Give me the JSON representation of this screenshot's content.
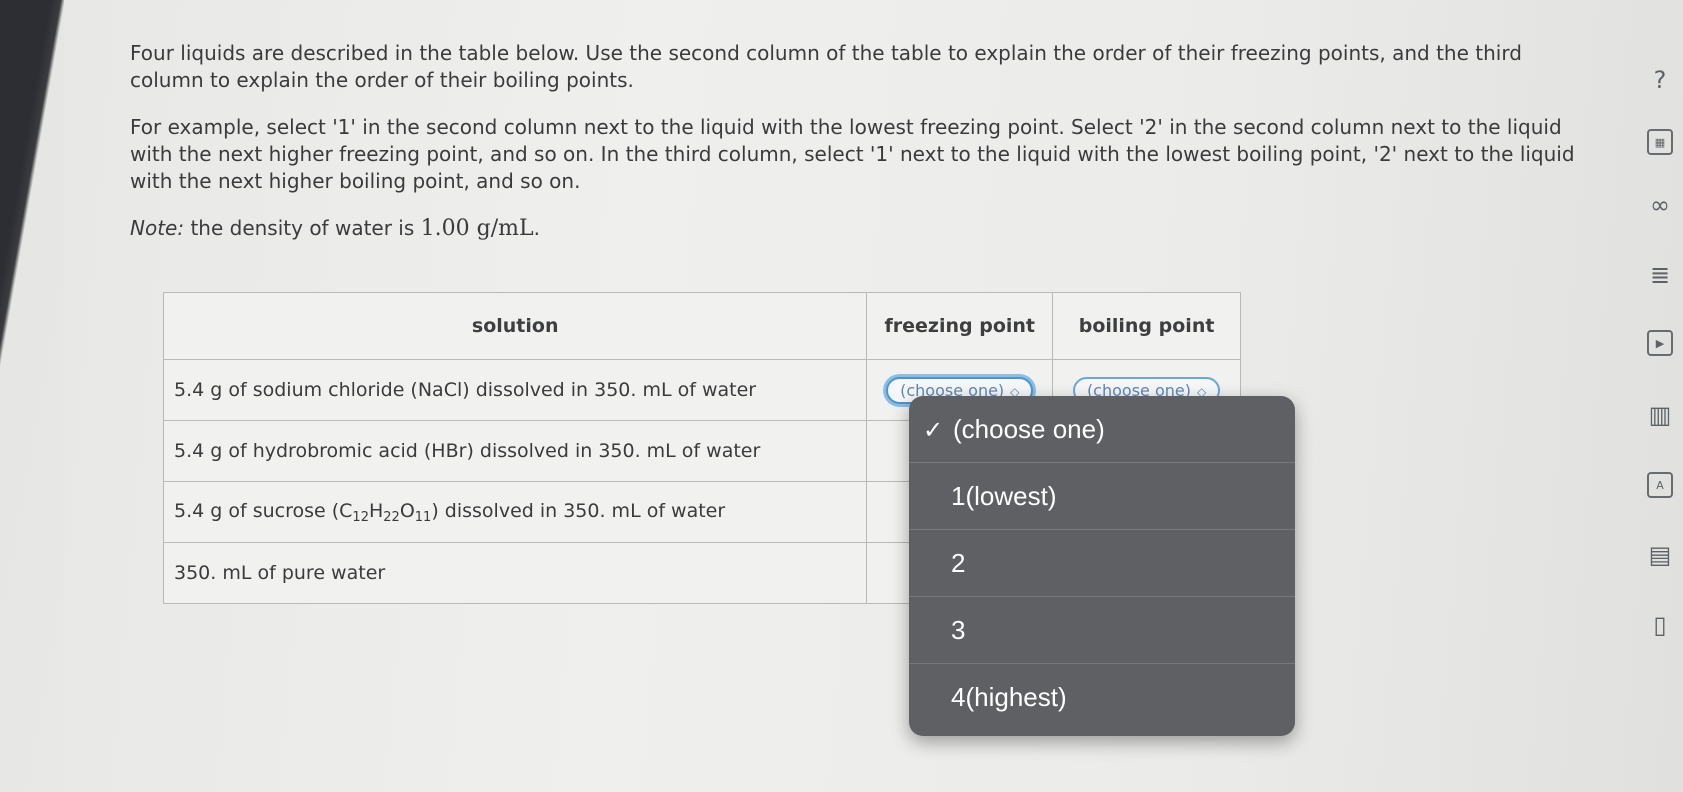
{
  "prompt": {
    "paragraph1": "Four liquids are described in the table below. Use the second column of the table to explain the order of their freezing points, and the third column to explain the order of their boiling points.",
    "paragraph2": "For example, select '1' in the second column next to the liquid with the lowest freezing point. Select '2' in the second column next to the liquid with the next higher freezing point, and so on. In the third column, select '1' next to the liquid with the lowest boiling point, '2' next to the liquid with the next higher boiling point, and so on.",
    "note_label": "Note:",
    "note_text": "the density of water is",
    "note_value": "1.00 g/mL",
    "note_end": "."
  },
  "table": {
    "headers": {
      "solution": "solution",
      "freezing": "freezing point",
      "boiling": "boiling point"
    },
    "rows": [
      {
        "text": "5.4 g of sodium chloride (NaCl) dissolved in 350. mL of water",
        "fp": "(choose one)",
        "bp": "(choose one)"
      },
      {
        "text": "5.4 g of hydrobromic acid (HBr) dissolved in 350. mL of water"
      },
      {
        "pre": "5.4 g of sucrose (C",
        "s1": "12",
        "h": "H",
        "s2": "22",
        "o": "O",
        "s3": "11",
        "post": ") dissolved in 350. mL of water"
      },
      {
        "text": "350. mL of pure water"
      }
    ]
  },
  "dropdown": {
    "check": "✓",
    "options": [
      "(choose one)",
      "1(lowest)",
      "2",
      "3",
      "4(highest)"
    ],
    "selected_index": 0
  },
  "toolbar": {
    "help": "?",
    "icons": [
      "question-icon",
      "calculator-icon",
      "infinity-icon",
      "notes-icon",
      "video-icon",
      "chart-icon",
      "periodic-table-icon",
      "book-icon",
      "bookmark-icon"
    ]
  }
}
